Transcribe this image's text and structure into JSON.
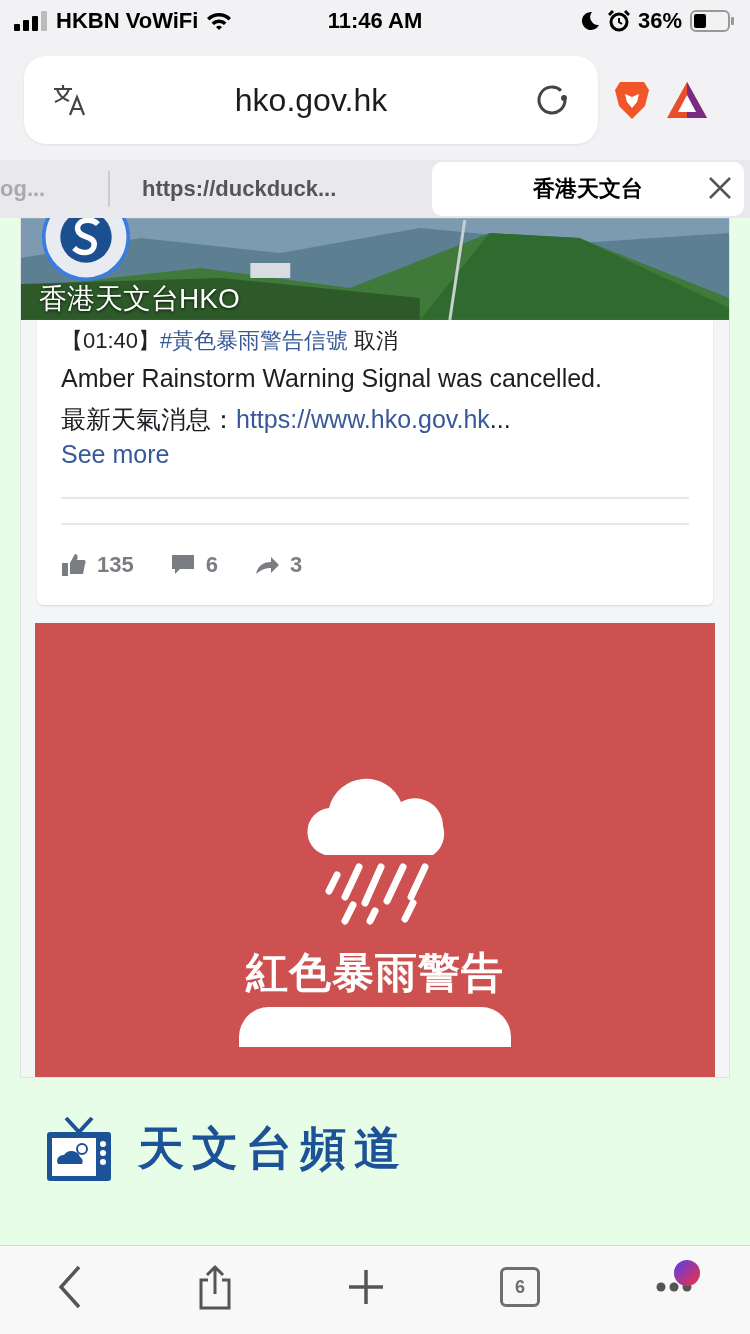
{
  "status_bar": {
    "carrier": "HKBN VoWiFi",
    "time": "11:46 AM",
    "battery": "36%"
  },
  "browser": {
    "url": "hko.gov.hk",
    "tabs": [
      {
        "label": "og...",
        "selected": false,
        "faded": true
      },
      {
        "label": "https://duckduck...",
        "selected": false,
        "faded": false
      },
      {
        "label": "香港天文台",
        "selected": true,
        "faded": false
      }
    ]
  },
  "post": {
    "page_name": "香港天文台HKO",
    "headline": "【01:40】",
    "hashtag": "#黃色暴雨警告信號",
    "headline_end": "取消",
    "english": "Amber Rainstorm Warning Signal was cancelled.",
    "label": "最新天氣消息：",
    "link": "https://www.hko.gov.hk",
    "ellipsis": "...",
    "see_more": "See more",
    "stats": [
      {
        "kind": "like",
        "count": "135"
      },
      {
        "kind": "comment",
        "count": "6"
      },
      {
        "kind": "share",
        "count": "3"
      }
    ]
  },
  "banner": {
    "title": "紅色暴雨警告"
  },
  "channel": {
    "title": "天文台頻道"
  },
  "toolbar": {
    "tab_count": "6"
  }
}
